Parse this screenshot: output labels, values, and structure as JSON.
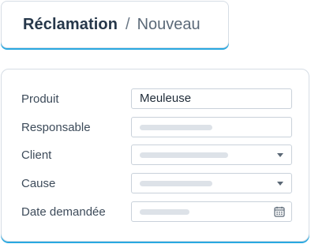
{
  "breadcrumb": {
    "title": "Réclamation",
    "separator": "/",
    "current": "Nouveau"
  },
  "form": {
    "fields": [
      {
        "label": "Produit",
        "value": "Meuleuse",
        "type": "text"
      },
      {
        "label": "Responsable",
        "value": "",
        "type": "text",
        "placeholder_fill": 0.45
      },
      {
        "label": "Client",
        "value": "",
        "type": "select",
        "placeholder_fill": 0.55,
        "icon": "chevron-down-icon"
      },
      {
        "label": "Cause",
        "value": "",
        "type": "select",
        "placeholder_fill": 0.45,
        "icon": "chevron-down-icon"
      },
      {
        "label": "Date demandée",
        "value": "",
        "type": "date",
        "placeholder_fill": 0.31,
        "icon": "calendar-icon"
      }
    ]
  },
  "colors": {
    "accent": "#29a8e0",
    "border": "#d6dde5",
    "placeholder": "#dde2e8",
    "text": "#26374a"
  }
}
